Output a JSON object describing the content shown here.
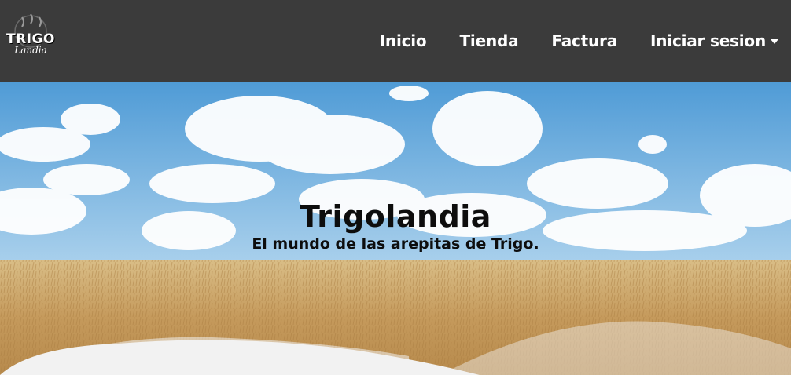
{
  "brand": {
    "logo_main": "TRIGO",
    "logo_sub": "Landia"
  },
  "nav": {
    "items": [
      {
        "label": "Inicio"
      },
      {
        "label": "Tienda"
      },
      {
        "label": "Factura"
      },
      {
        "label": "Iniciar sesion"
      }
    ]
  },
  "hero": {
    "title": "Trigolandia",
    "subtitle": "El mundo de las arepitas de Trigo."
  },
  "colors": {
    "navbar": "#3b3b3b",
    "sky": "#5fa6d8",
    "wheat": "#c9a266",
    "wave": "#f2f2f2"
  }
}
